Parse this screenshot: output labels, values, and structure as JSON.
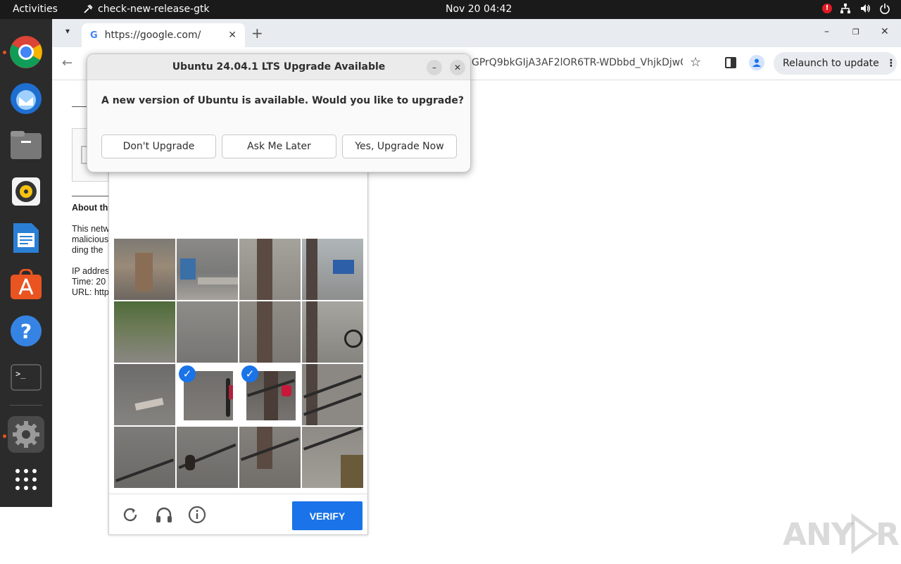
{
  "topbar": {
    "activities": "Activities",
    "app_name": "check-new-release-gtk",
    "clock": "Nov 20  04:42",
    "tray_icons": [
      "alert-icon",
      "network-icon",
      "volume-icon",
      "power-icon"
    ]
  },
  "dock": {
    "items": [
      "chrome",
      "thunderbird",
      "files",
      "rhythmbox",
      "libreoffice-writer",
      "app-center",
      "help",
      "terminal",
      "settings",
      "show-apps"
    ]
  },
  "browser": {
    "tab_title": "https://google.com/",
    "tab_favicon": "G",
    "url_partial": "GPrQ9bkGIjA3AF2lOR6TR-WDbbd_VhjkDjwO...",
    "relaunch_label": "Relaunch to update",
    "accent": "#1a73e8"
  },
  "page": {
    "about_heading": "About th",
    "line1": "This netw",
    "line2": "malicious",
    "line3": "ding the",
    "ip_label": "IP addres",
    "time_label": "Time: 20",
    "url_label": "URL: http"
  },
  "captcha": {
    "selected_tiles": [
      9,
      10
    ],
    "verify_label": "VERIFY"
  },
  "dialog": {
    "title": "Ubuntu 24.04.1 LTS Upgrade Available",
    "message": "A new version of Ubuntu is available. Would you like to upgrade?",
    "buttons": {
      "dont_upgrade": "Don't Upgrade",
      "ask_later": "Ask Me Later",
      "upgrade_now": "Yes, Upgrade Now"
    }
  },
  "watermark": "ANY RUN"
}
